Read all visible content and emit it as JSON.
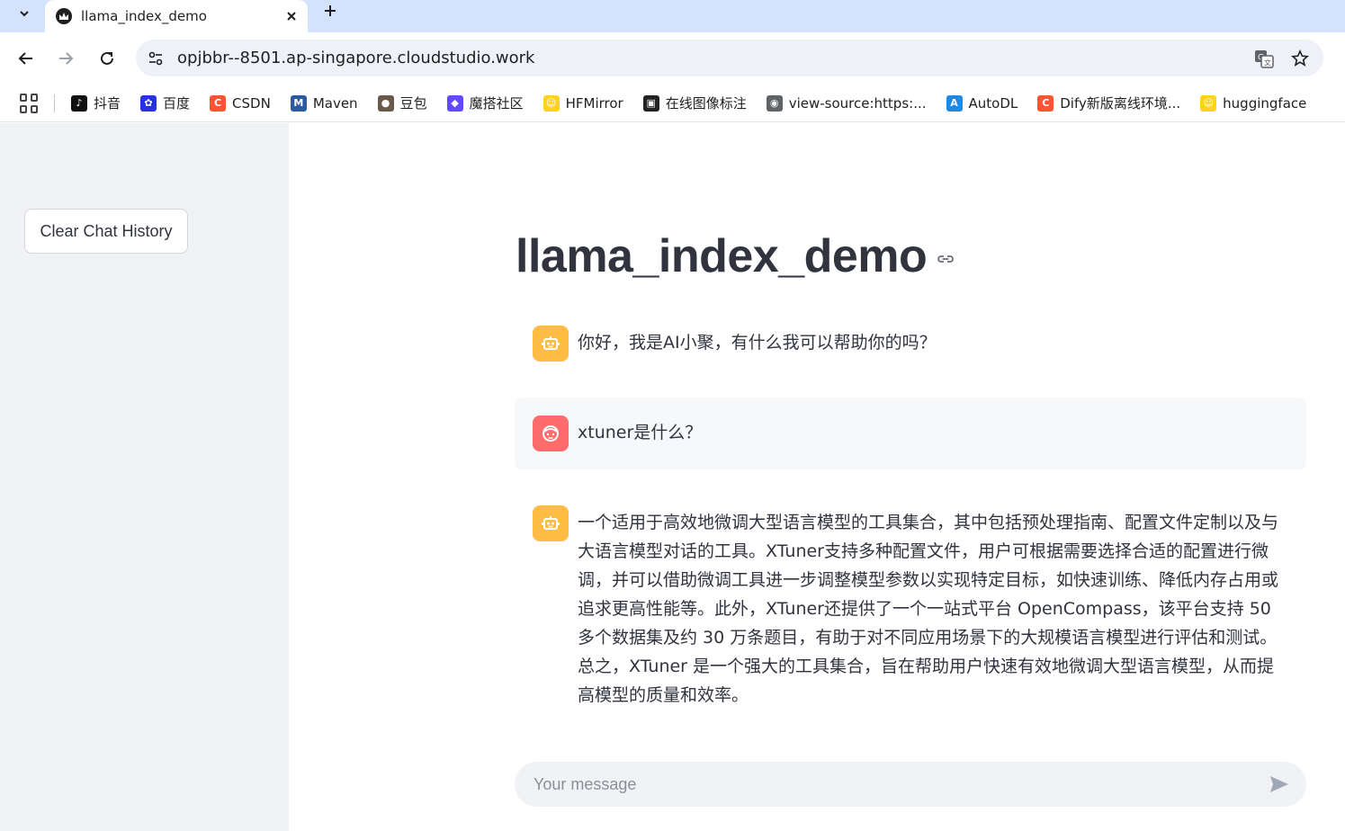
{
  "browser": {
    "tab_title": "llama_index_demo",
    "url": "opjbbr--8501.ap-singapore.cloudstudio.work",
    "bookmarks": [
      {
        "label": "抖音",
        "icon": "douyin-icon",
        "color": "#111111",
        "glyph": "♪"
      },
      {
        "label": "百度",
        "icon": "baidu-paw-icon",
        "color": "#2932e1",
        "glyph": "✿"
      },
      {
        "label": "CSDN",
        "icon": "csdn-icon",
        "color": "#fc5531",
        "glyph": "C"
      },
      {
        "label": "Maven",
        "icon": "maven-icon",
        "color": "#2c5aa0",
        "glyph": "M"
      },
      {
        "label": "豆包",
        "icon": "doubao-icon",
        "color": "#6b5a4a",
        "glyph": "●"
      },
      {
        "label": "魔搭社区",
        "icon": "modelscope-icon",
        "color": "#624aff",
        "glyph": "◆"
      },
      {
        "label": "HFMirror",
        "icon": "hf-mirror-icon",
        "color": "#ffd21e",
        "glyph": "☺"
      },
      {
        "label": "在线图像标注",
        "icon": "image-annotate-icon",
        "color": "#222222",
        "glyph": "▣"
      },
      {
        "label": "view-source:https:...",
        "icon": "globe-icon",
        "color": "#5f6368",
        "glyph": "◉"
      },
      {
        "label": "AutoDL",
        "icon": "autodl-icon",
        "color": "#1e88e5",
        "glyph": "A"
      },
      {
        "label": "Dify新版离线环境...",
        "icon": "dify-csdn-icon",
        "color": "#fc5531",
        "glyph": "C"
      },
      {
        "label": "huggingface",
        "icon": "huggingface-icon",
        "color": "#ffd21e",
        "glyph": "☺"
      }
    ]
  },
  "sidebar": {
    "clear_label": "Clear Chat History"
  },
  "main": {
    "title": "llama_index_demo",
    "messages": [
      {
        "role": "assistant",
        "text": "你好，我是AI小聚，有什么我可以帮助你的吗？"
      },
      {
        "role": "user",
        "text": "xtuner是什么？"
      },
      {
        "role": "assistant",
        "text": "一个适用于高效地微调大型语言模型的工具集合，其中包括预处理指南、配置文件定制以及与大语言模型对话的工具。XTuner支持多种配置文件，用户可根据需要选择合适的配置进行微调，并可以借助微调工具进一步调整模型参数以实现特定目标，如快速训练、降低内存占用或追求更高性能等。此外，XTuner还提供了一个一站式平台 OpenCompass，该平台支持 50 多个数据集及约 30 万条题目，有助于对不同应用场景下的大规模语言模型进行评估和测试。总之，XTuner 是一个强大的工具集合，旨在帮助用户快速有效地微调大型语言模型，从而提高模型的质量和效率。"
      }
    ],
    "input_placeholder": "Your message"
  },
  "colors": {
    "sidebar_bg": "#f0f2f6",
    "bot_avatar": "#ffbd45",
    "user_avatar": "#ff6c6c",
    "text": "#31333f"
  }
}
